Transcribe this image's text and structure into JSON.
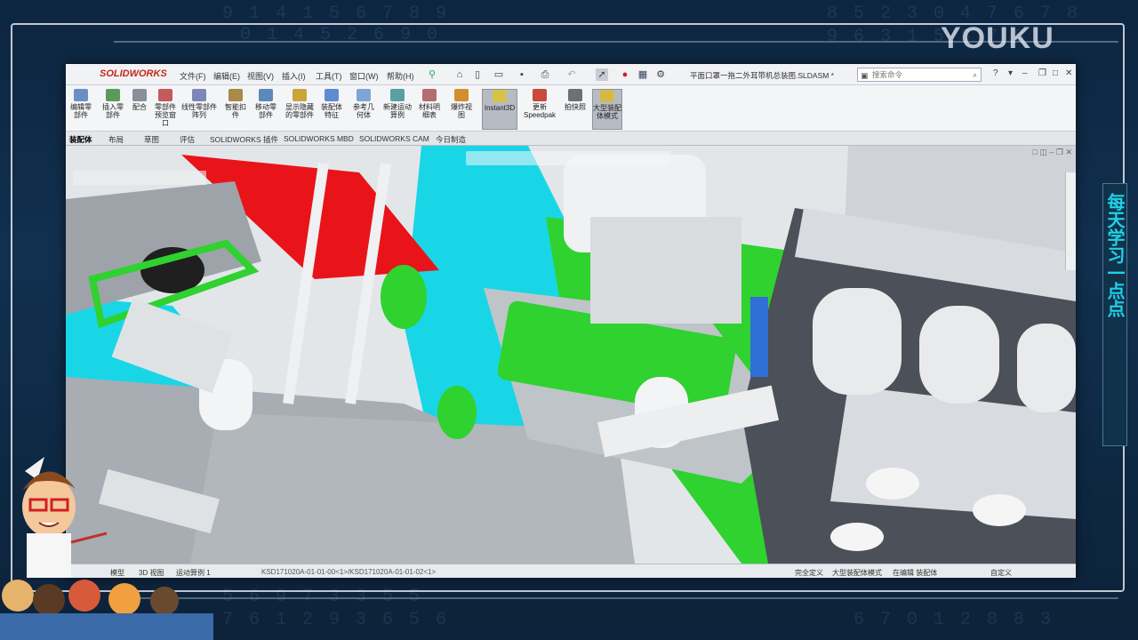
{
  "watermark": "YOUKU",
  "side_banner": "每天学习一点点",
  "app": {
    "logo_brand": "SOLIDWORKS",
    "menu": [
      "文件(F)",
      "编辑(E)",
      "视图(V)",
      "插入(I)",
      "工具(T)",
      "窗口(W)",
      "帮助(H)"
    ],
    "document_title": "平面口罩一拖二外耳带机总装图.SLDASM *",
    "search_placeholder": "搜索命令",
    "ribbon": [
      {
        "label": "编辑零部件",
        "icon": "edit-component-icon"
      },
      {
        "label": "插入零部件",
        "icon": "insert-component-icon"
      },
      {
        "label": "配合",
        "icon": "mate-icon"
      },
      {
        "label": "零部件预览窗口",
        "icon": "component-preview-icon"
      },
      {
        "label": "线性零部件阵列",
        "icon": "linear-pattern-icon"
      },
      {
        "label": "智能扣件",
        "icon": "smart-fasteners-icon"
      },
      {
        "label": "移动零部件",
        "icon": "move-component-icon"
      },
      {
        "label": "显示隐藏的零部件",
        "icon": "show-hidden-icon"
      },
      {
        "label": "装配体特征",
        "icon": "assembly-features-icon"
      },
      {
        "label": "参考几何体",
        "icon": "reference-geometry-icon"
      },
      {
        "label": "新建运动算例",
        "icon": "new-motion-study-icon"
      },
      {
        "label": "材料明细表",
        "icon": "bill-of-materials-icon"
      },
      {
        "label": "爆炸视图",
        "icon": "exploded-view-icon"
      },
      {
        "label": "Instant3D",
        "icon": "instant3d-icon"
      },
      {
        "label": "更新Speedpak",
        "icon": "speedpak-icon"
      },
      {
        "label": "拍快照",
        "icon": "snapshot-icon"
      },
      {
        "label": "大型装配体模式",
        "icon": "large-assembly-icon"
      }
    ],
    "tabs": [
      "装配体",
      "布局",
      "草图",
      "评估",
      "SOLIDWORKS 插件",
      "SOLIDWORKS MBD",
      "SOLIDWORKS CAM",
      "今日制造"
    ],
    "bottom_tabs": [
      "模型",
      "3D 视图",
      "运动算例 1"
    ],
    "status": {
      "path": "KSD171020A-01-01-00<1>/KSD171020A-01-01-02<1>",
      "definition": "完全定义",
      "mode": "大型装配体模式",
      "editing": "在编辑 装配体",
      "custom": "自定义"
    }
  },
  "colors": {
    "accent_red": "#e8141a",
    "accent_green": "#2fd22f",
    "accent_cyan": "#19d6e6",
    "sw_red": "#c4281c",
    "bg_blue": "#0d2540"
  }
}
